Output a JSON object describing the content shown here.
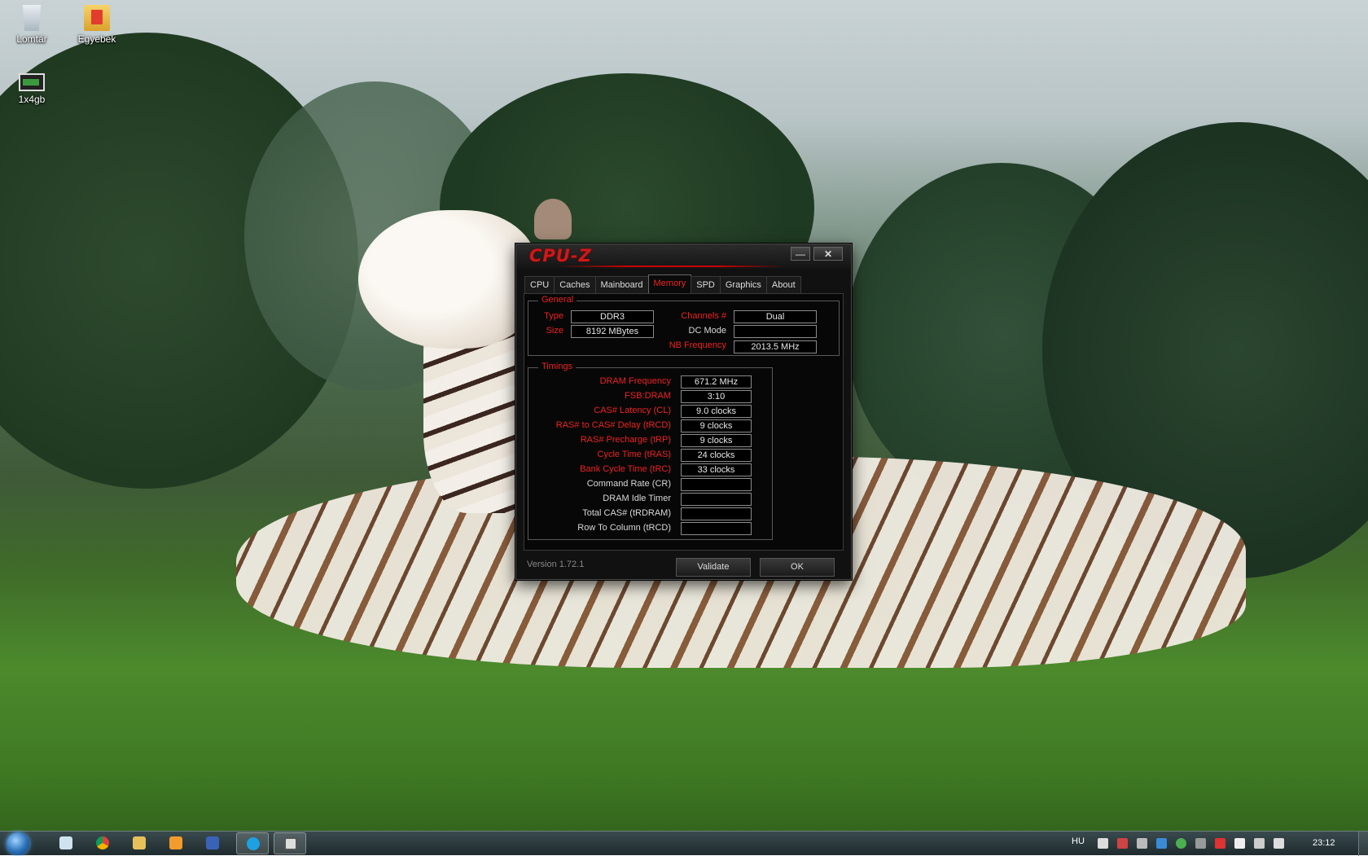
{
  "desktop": {
    "icons": [
      {
        "label": "Lomtár"
      },
      {
        "label": "Egyebek"
      },
      {
        "label": "1x4gb"
      }
    ]
  },
  "cpuz": {
    "title": "CPU-Z",
    "window_buttons": {
      "minimize": "—",
      "close": "✕"
    },
    "tabs": [
      "CPU",
      "Caches",
      "Mainboard",
      "Memory",
      "SPD",
      "Graphics",
      "About"
    ],
    "active_tab": "Memory",
    "general": {
      "title": "General",
      "type_label": "Type",
      "type_value": "DDR3",
      "size_label": "Size",
      "size_value": "8192 MBytes",
      "channels_label": "Channels #",
      "channels_value": "Dual",
      "dcmode_label": "DC Mode",
      "dcmode_value": "",
      "nbfreq_label": "NB Frequency",
      "nbfreq_value": "2013.5 MHz"
    },
    "timings": {
      "title": "Timings",
      "rows": [
        {
          "label": "DRAM Frequency",
          "value": "671.2 MHz"
        },
        {
          "label": "FSB:DRAM",
          "value": "3:10"
        },
        {
          "label": "CAS# Latency (CL)",
          "value": "9.0 clocks"
        },
        {
          "label": "RAS# to CAS# Delay (tRCD)",
          "value": "9 clocks"
        },
        {
          "label": "RAS# Precharge (tRP)",
          "value": "9 clocks"
        },
        {
          "label": "Cycle Time (tRAS)",
          "value": "24 clocks"
        },
        {
          "label": "Bank Cycle Time (tRC)",
          "value": "33 clocks"
        },
        {
          "label": "Command Rate (CR)",
          "value": ""
        },
        {
          "label": "DRAM Idle Timer",
          "value": ""
        },
        {
          "label": "Total CAS# (tRDRAM)",
          "value": ""
        },
        {
          "label": "Row To Column (tRCD)",
          "value": ""
        }
      ]
    },
    "version": "Version 1.72.1",
    "validate_label": "Validate",
    "ok_label": "OK",
    "colors": {
      "accent": "#e02020",
      "background": "#070707"
    }
  },
  "taskbar": {
    "language": "HU",
    "clock": "23:12"
  }
}
